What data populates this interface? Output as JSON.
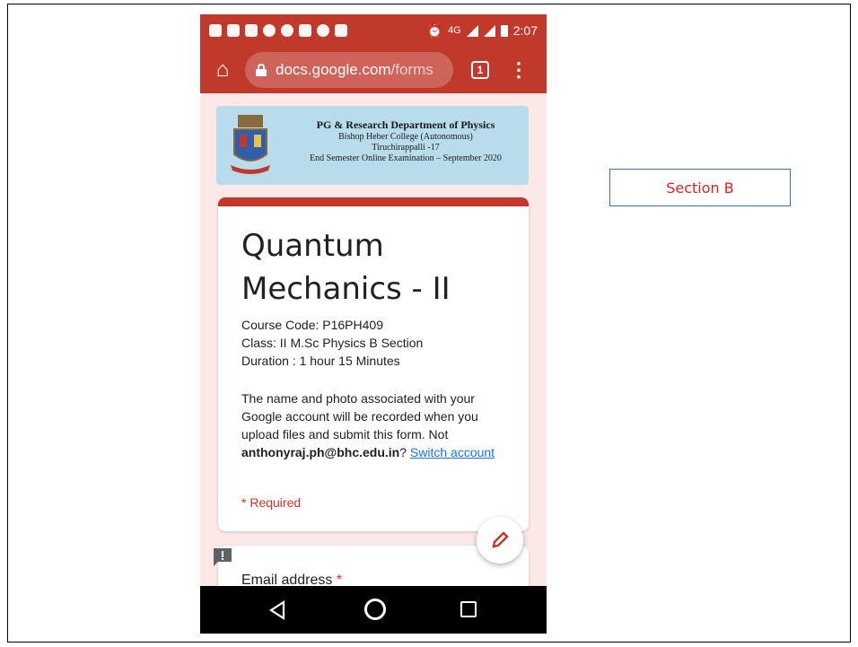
{
  "status_bar": {
    "time": "2:07",
    "network": "4G"
  },
  "browser": {
    "url_host": "docs.google.com",
    "url_path": "/forms",
    "tab_count": "1"
  },
  "banner": {
    "department": "PG & Research Department of Physics",
    "college": "Bishop Heber College (Autonomous)",
    "city": "Tiruchirappalli -17",
    "exam": "End Semester Online Examination – September 2020"
  },
  "form": {
    "title": "Quantum Mechanics - II",
    "course_code": "Course Code: P16PH409",
    "class": "Class: II M.Sc Physics B Section",
    "duration": "Duration : 1 hour 15 Minutes",
    "account_note_prefix": "The name and photo associated with your Google account will be recorded when you upload files and submit this form. Not ",
    "account_email": "anthonyraj.ph@bhc.edu.in",
    "account_q": "? ",
    "switch_account": "Switch account",
    "required_note": "* Required",
    "email_label": "Email address",
    "email_required_mark": "*"
  },
  "slide": {
    "section_label": "Section B"
  },
  "colors": {
    "brand_red": "#c0392b",
    "banner_blue": "#b9dcec",
    "section_text": "#e0212b"
  }
}
